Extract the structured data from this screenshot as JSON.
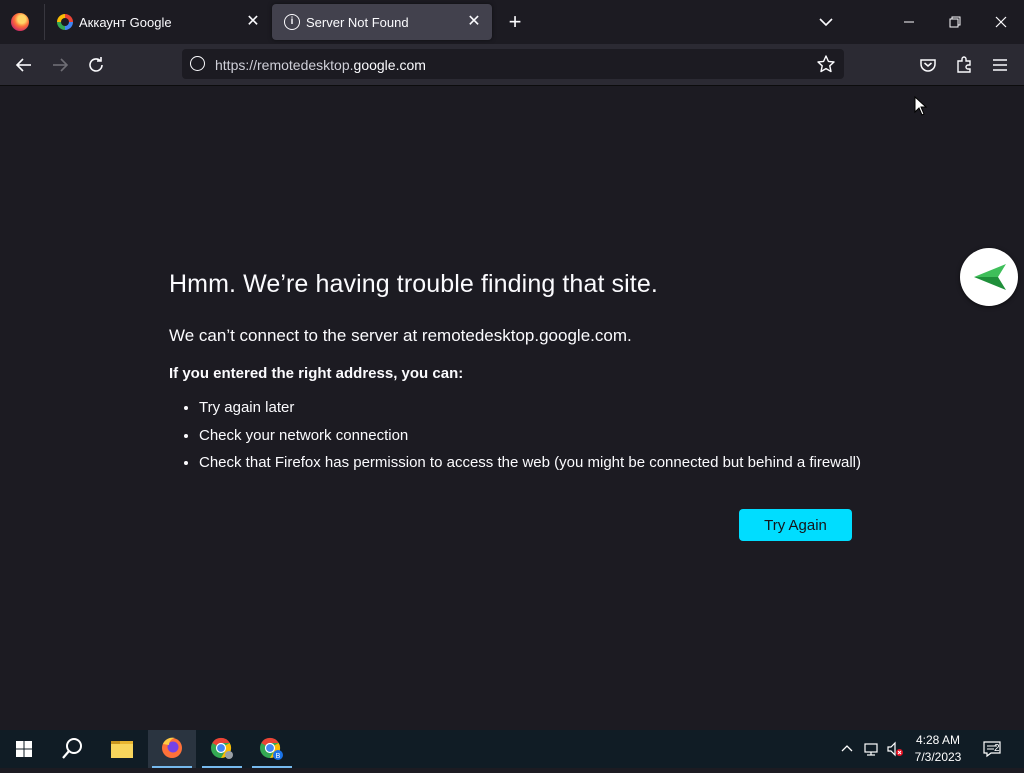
{
  "browser": {
    "tabs": [
      {
        "title": "Аккаунт Google",
        "icon": "google-g-icon",
        "active": false
      },
      {
        "title": "Server Not Found",
        "icon": "info-icon",
        "active": true
      }
    ],
    "url": {
      "prefix": "https://remotedesktop.",
      "host": "google.com"
    }
  },
  "error_page": {
    "title": "Hmm. We’re having trouble finding that site.",
    "description": "We can’t connect to the server at remotedesktop.google.com.",
    "lead": "If you entered the right address, you can:",
    "suggestions": [
      "Try again later",
      "Check your network connection",
      "Check that Firefox has permission to access the web (you might be connected but behind a firewall)"
    ],
    "try_again_label": "Try Again",
    "accent_color": "#00ddff"
  },
  "taskbar": {
    "apps": [
      "windows-start-icon",
      "search-icon",
      "file-explorer-icon",
      "firefox-icon",
      "chrome-icon",
      "chrome-profile-icon"
    ],
    "chrome_profile_badge": "B",
    "clock_time": "4:28 AM",
    "clock_date": "7/3/2023",
    "notification_count": "2"
  }
}
